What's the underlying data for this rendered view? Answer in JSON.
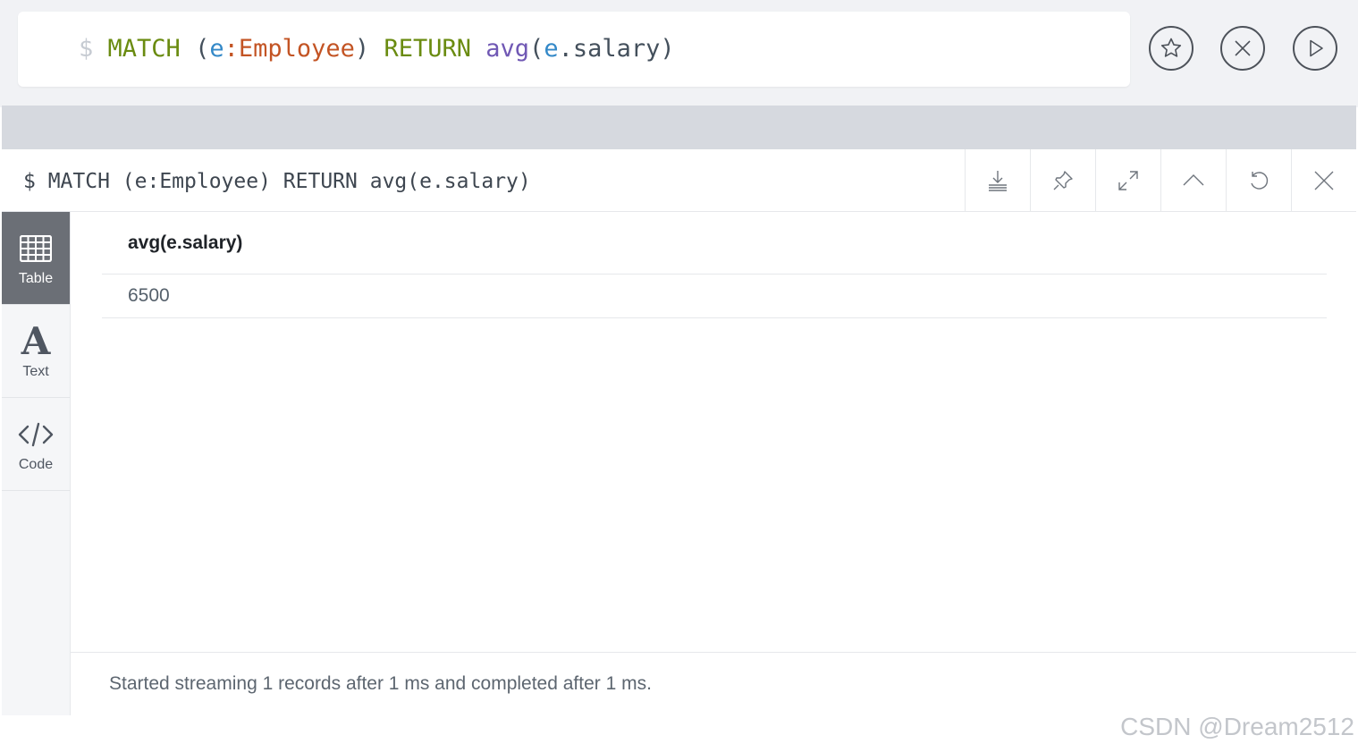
{
  "editor": {
    "prompt": "$",
    "tokens": {
      "kw_match": "MATCH",
      "paren_open": "(",
      "var_e": "e",
      "colon": ":",
      "label": "Employee",
      "paren_close": ")",
      "kw_return": "RETURN",
      "fn_avg": "avg",
      "paren_open2": "(",
      "var_e2": "e",
      "dot_prop": ".salary",
      "paren_close2": ")"
    },
    "buttons": {
      "favorite_icon": "star-icon",
      "clear_icon": "close-circle-icon",
      "run_icon": "play-icon"
    }
  },
  "frame": {
    "title": "$ MATCH (e:Employee) RETURN avg(e.salary)",
    "actions": [
      "download-icon",
      "pin-icon",
      "expand-icon",
      "collapse-icon",
      "rerun-icon",
      "close-icon"
    ]
  },
  "views": [
    {
      "label": "Table",
      "icon": "table-icon",
      "active": true
    },
    {
      "label": "Text",
      "icon": "text-icon",
      "active": false
    },
    {
      "label": "Code",
      "icon": "code-icon",
      "active": false
    }
  ],
  "table": {
    "columns": [
      "avg(e.salary)"
    ],
    "rows": [
      [
        "6500"
      ]
    ]
  },
  "status": "Started streaming 1 records after 1 ms and completed after 1 ms.",
  "watermark": "CSDN @Dream2512",
  "colors": {
    "keyword": "#6a8b10",
    "variable": "#3489c8",
    "label": "#c35424",
    "function": "#7058b4",
    "active_tab": "#6b6f76"
  }
}
